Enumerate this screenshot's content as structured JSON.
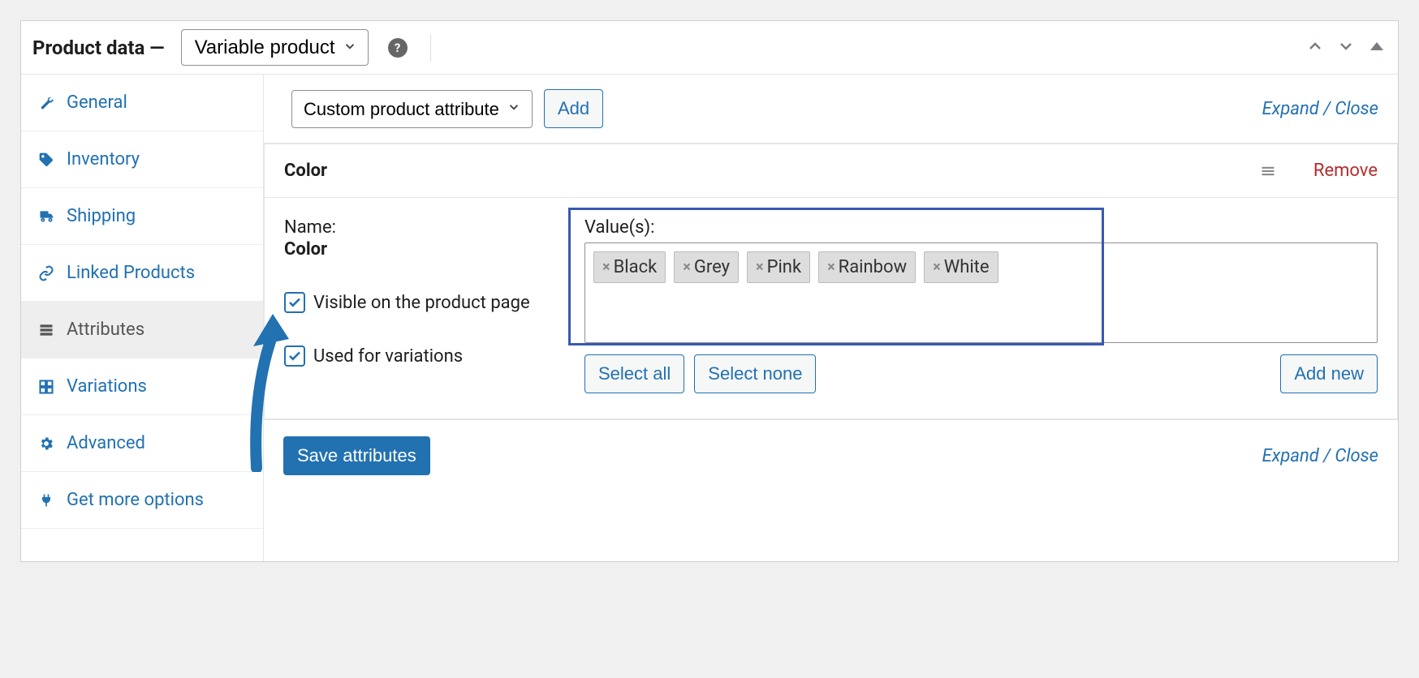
{
  "header": {
    "title": "Product data —",
    "product_type": "Variable product"
  },
  "sidebar": {
    "items": [
      {
        "label": "General"
      },
      {
        "label": "Inventory"
      },
      {
        "label": "Shipping"
      },
      {
        "label": "Linked Products"
      },
      {
        "label": "Attributes"
      },
      {
        "label": "Variations"
      },
      {
        "label": "Advanced"
      },
      {
        "label": "Get more options"
      }
    ]
  },
  "toolbar": {
    "attribute_select": "Custom product attribute",
    "add": "Add",
    "expand_close": "Expand / Close"
  },
  "attribute": {
    "title": "Color",
    "remove": "Remove",
    "name_label": "Name:",
    "name_value": "Color",
    "visible_label": "Visible on the product page",
    "used_for_variations_label": "Used for variations",
    "values_label": "Value(s):",
    "values": [
      "Black",
      "Grey",
      "Pink",
      "Rainbow",
      "White"
    ],
    "select_all": "Select all",
    "select_none": "Select none",
    "add_new": "Add new"
  },
  "footer": {
    "save": "Save attributes",
    "expand_close": "Expand / Close"
  }
}
